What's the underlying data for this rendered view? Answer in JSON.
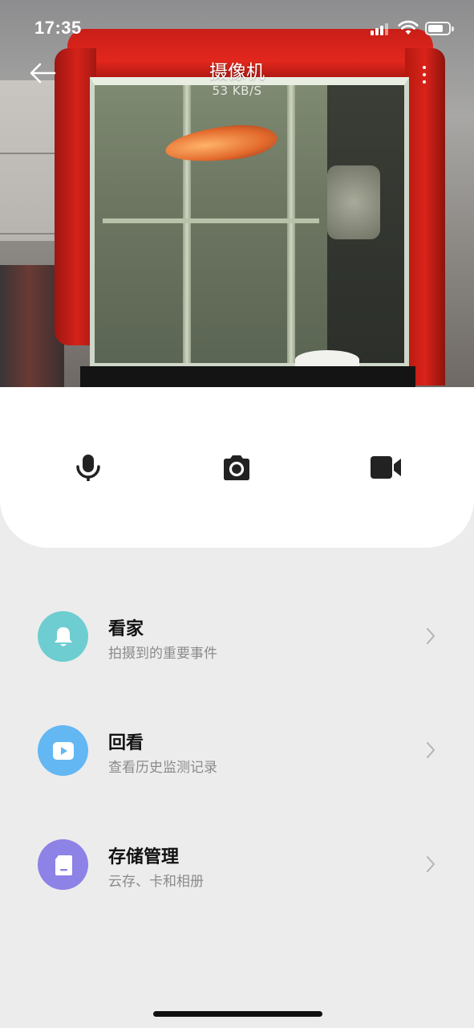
{
  "status_bar": {
    "time": "17:35"
  },
  "nav": {
    "title": "摄像机",
    "speed": "53 KB/S"
  },
  "controls": {
    "mic_icon": "microphone-icon",
    "camera_icon": "camera-icon",
    "video_icon": "video-icon"
  },
  "menu": {
    "items": [
      {
        "title": "看家",
        "subtitle": "拍摄到的重要事件",
        "icon": "bell-icon",
        "color": "#6ecdd0"
      },
      {
        "title": "回看",
        "subtitle": "查看历史监测记录",
        "icon": "play-icon",
        "color": "#63b7f2"
      },
      {
        "title": "存储管理",
        "subtitle": "云存、卡和相册",
        "icon": "sd-card-icon",
        "color": "#8d82e6"
      }
    ]
  }
}
